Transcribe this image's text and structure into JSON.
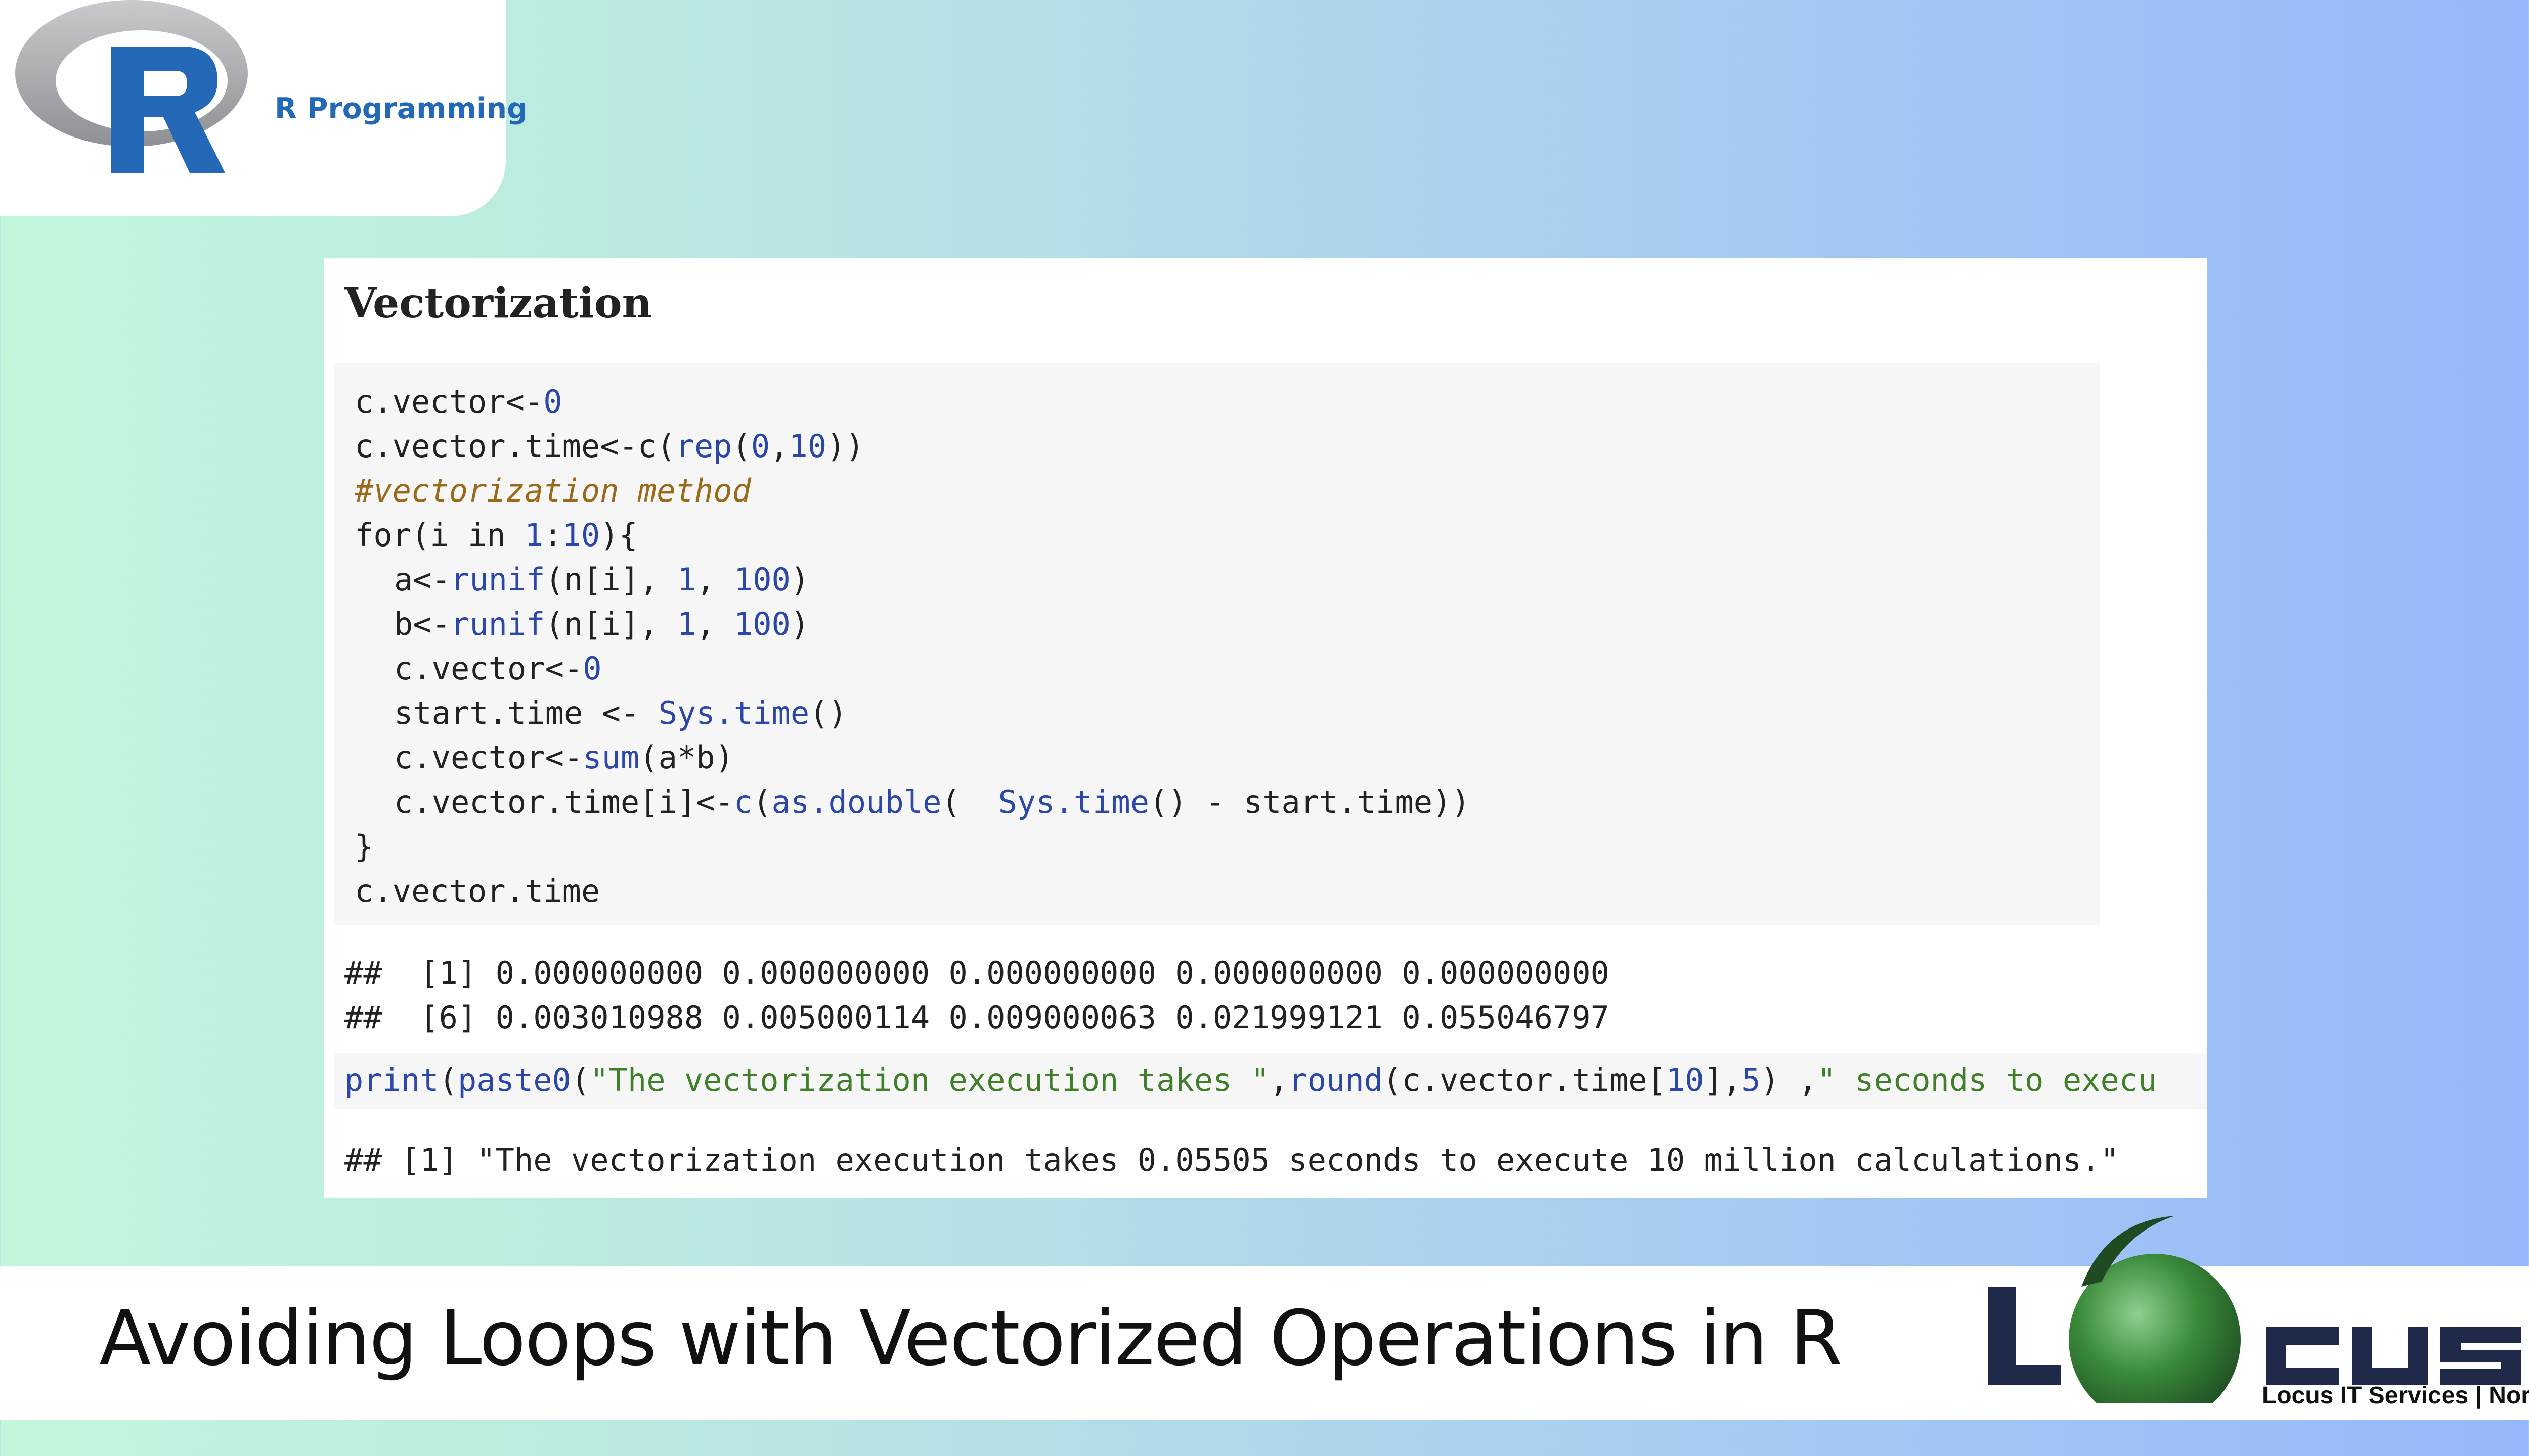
{
  "r_logo": {
    "label": "R Programming"
  },
  "panel": {
    "title": "Vectorization",
    "code": [
      "c.vector<-0",
      "c.vector.time<-c(rep(0,10))",
      "#vectorization method",
      "for(i in 1:10){",
      "a<-runif(n[i], 1, 100)",
      "b<-runif(n[i], 1, 100)",
      "c.vector<-0",
      "start.time <- Sys.time()",
      "c.vector<-sum(a*b)",
      "c.vector.time[i]<-c(as.double(  Sys.time() - start.time))",
      "}",
      "c.vector.time"
    ],
    "output": [
      "##  [1] 0.000000000 0.000000000 0.000000000 0.000000000 0.000000000",
      "##  [6] 0.003010988 0.005000114 0.009000063 0.021999121 0.055046797"
    ],
    "print_code": "print(paste0(\"The vectorization execution takes \",round(c.vector.time[10],5) ,\" seconds to execu",
    "print_output": "## [1] \"The vectorization execution takes 0.05505 seconds to execute 10 million calculations.\""
  },
  "banner": {
    "title": "Avoiding Loops with Vectorized Operations in R",
    "brand_logo": "LOCUS",
    "brand_subtitle": "Locus IT Services | Nordic"
  },
  "colors": {
    "r_blue": "#2369b8",
    "locus_navy": "#1f2a4a",
    "locus_green": "#3a8a3a"
  }
}
